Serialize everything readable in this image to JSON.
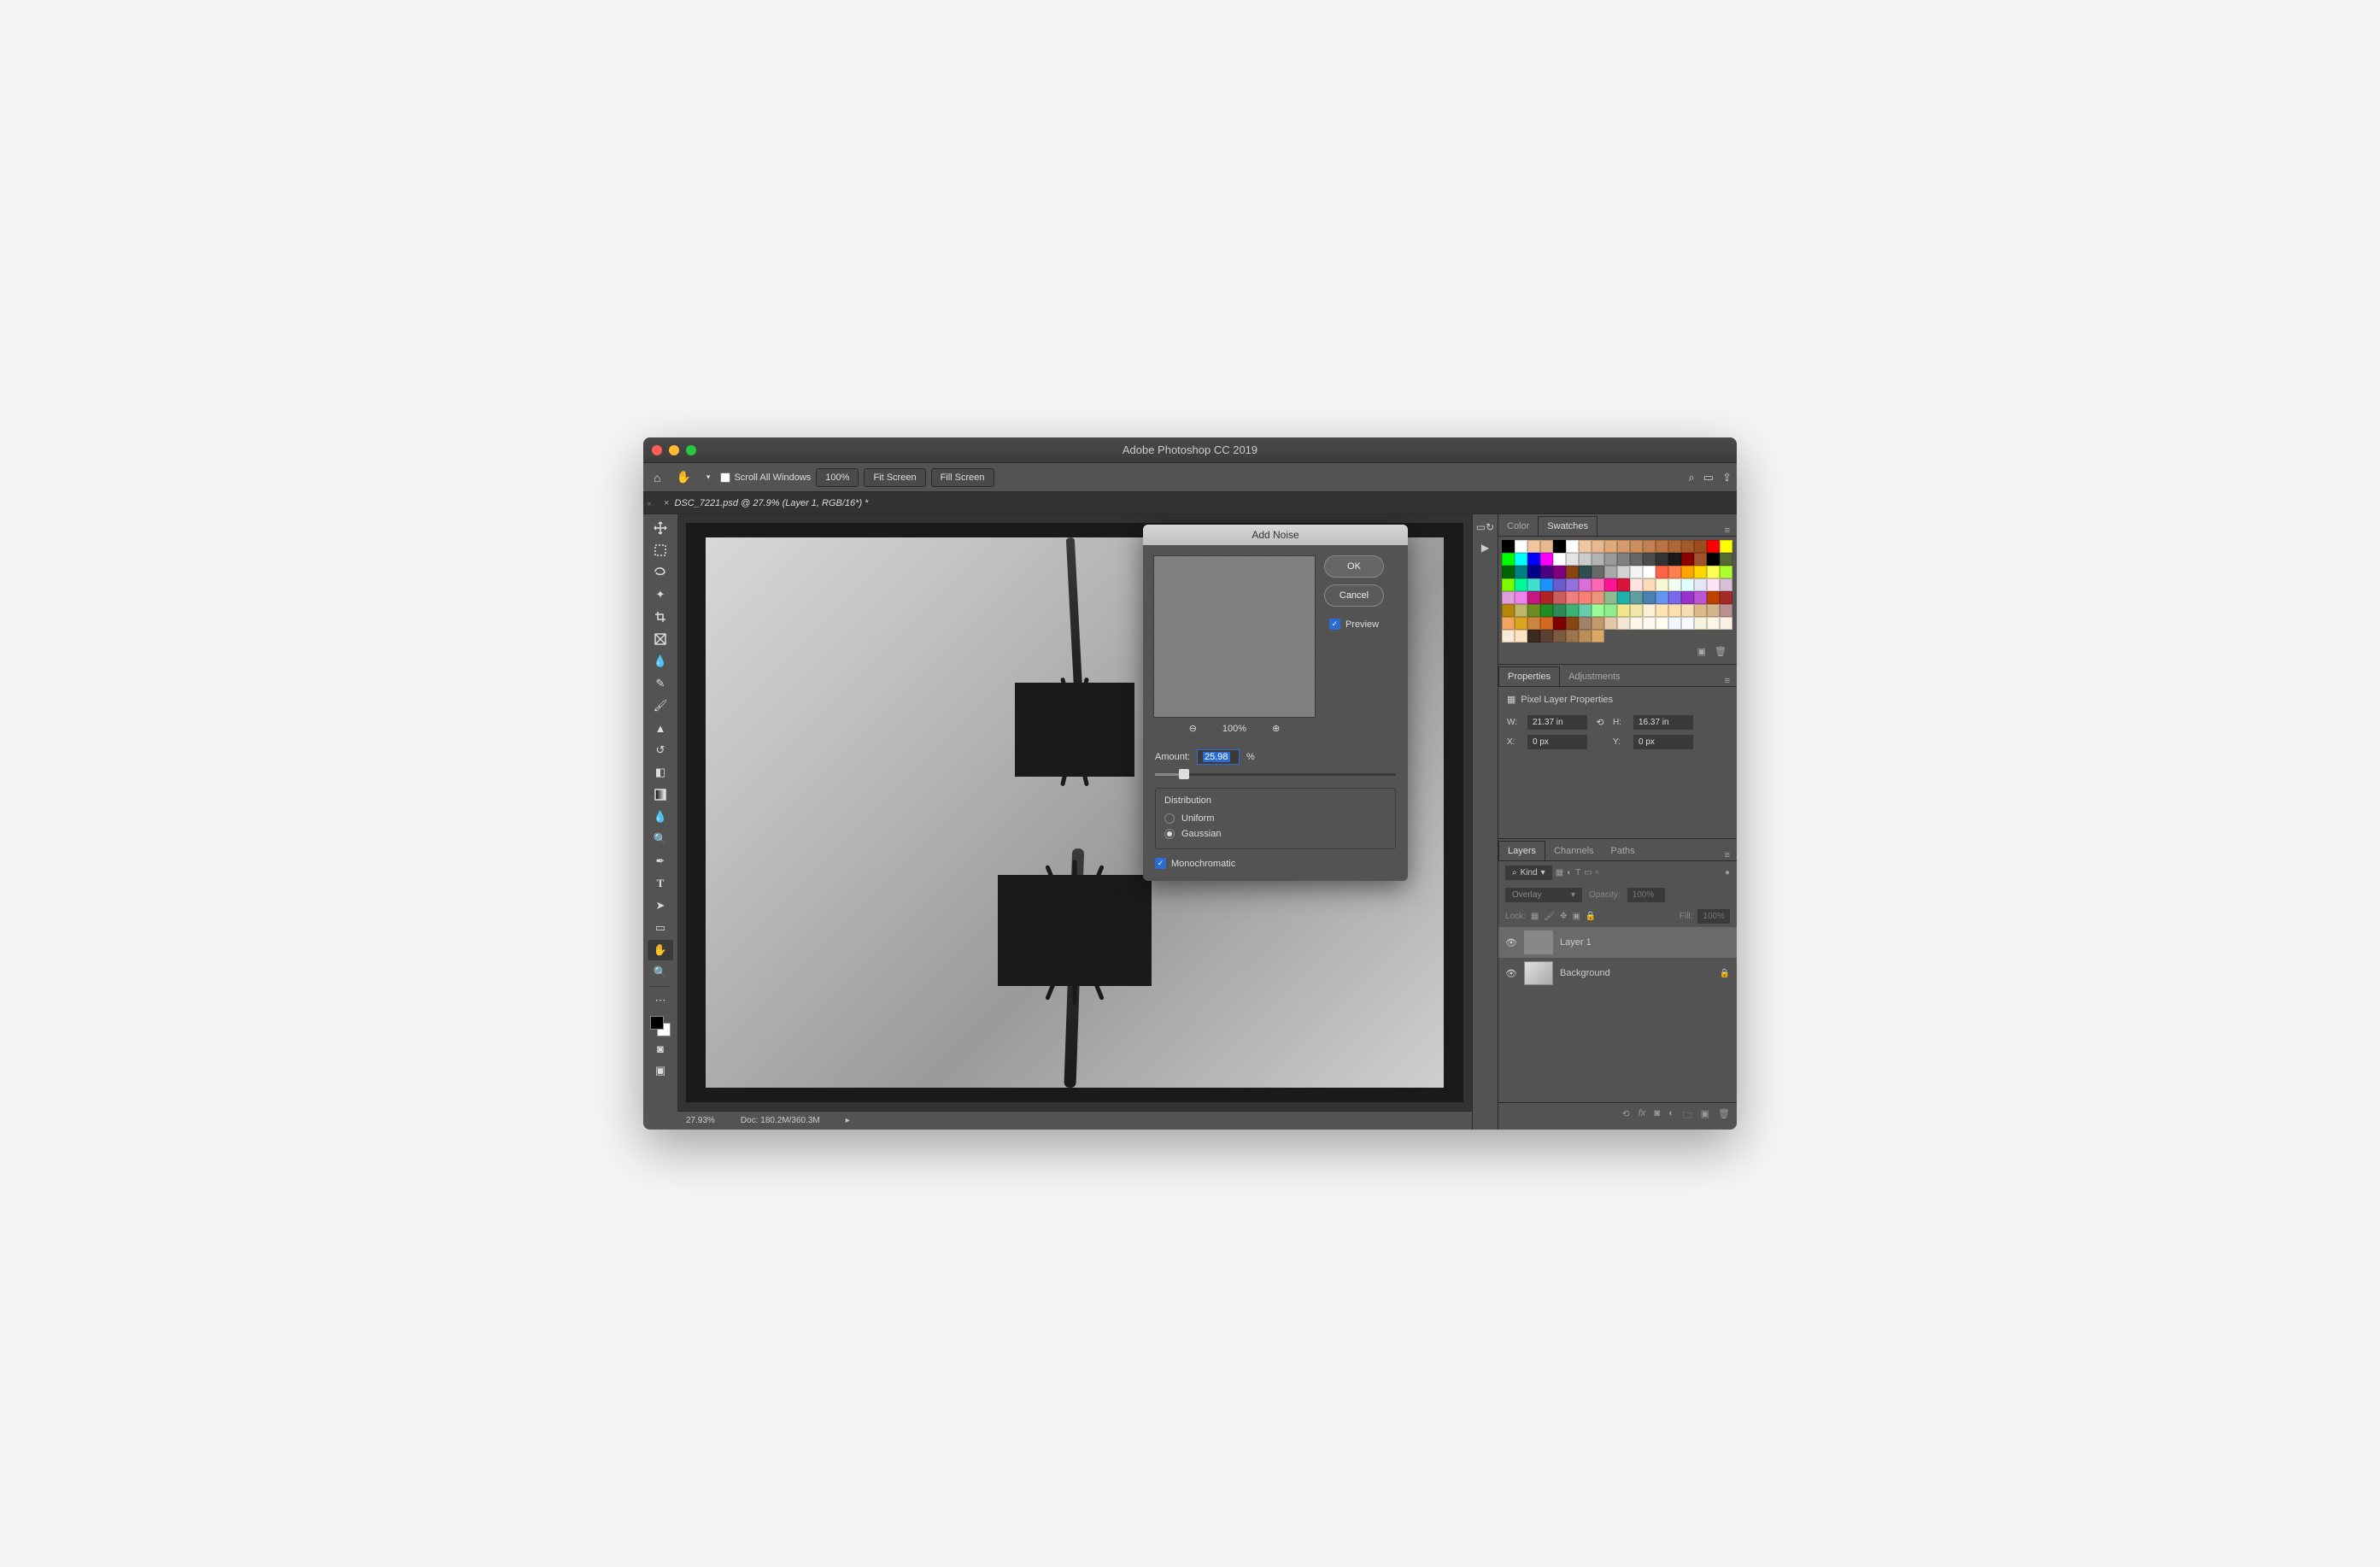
{
  "app": {
    "title": "Adobe Photoshop CC 2019"
  },
  "optionsBar": {
    "scrollAll": "Scroll All Windows",
    "zoomBtn": "100%",
    "fitScreen": "Fit Screen",
    "fillScreen": "Fill Screen"
  },
  "documentTab": "DSC_7221.psd @ 27.9% (Layer 1, RGB/16*) *",
  "statusBar": {
    "zoom": "27.93%",
    "docsize": "Doc: 180.2M/360.3M"
  },
  "panels": {
    "colorTab": "Color",
    "swatchesTab": "Swatches",
    "propertiesTab": "Properties",
    "adjustmentsTab": "Adjustments",
    "layersTab": "Layers",
    "channelsTab": "Channels",
    "pathsTab": "Paths"
  },
  "properties": {
    "heading": "Pixel Layer Properties",
    "W": "21.37 in",
    "H": "16.37 in",
    "X": "0 px",
    "Y": "0 px"
  },
  "layers": {
    "kind": "Kind",
    "blend": "Overlay",
    "opacityLabel": "Opacity:",
    "opacity": "100%",
    "lockLabel": "Lock:",
    "fillLabel": "Fill:",
    "fill": "100%",
    "items": [
      {
        "name": "Layer 1",
        "selected": true,
        "locked": false
      },
      {
        "name": "Background",
        "selected": false,
        "locked": true
      }
    ]
  },
  "dialog": {
    "title": "Add Noise",
    "ok": "OK",
    "cancel": "Cancel",
    "preview": "Preview",
    "previewZoom": "100%",
    "amountLabel": "Amount:",
    "amount": "25.98",
    "pct": "%",
    "distributionLabel": "Distribution",
    "uniform": "Uniform",
    "gaussian": "Gaussian",
    "mono": "Monochromatic"
  },
  "swatchColors": [
    "#000000",
    "#ffffff",
    "#f2c6a0",
    "#e8b98f",
    "#000000",
    "#ffffff",
    "#f2c6a0",
    "#e8b98f",
    "#dfa87a",
    "#d59b6c",
    "#cc8e5e",
    "#c28150",
    "#b97443",
    "#af6736",
    "#a55a2a",
    "#9b4d1e",
    "#ff0000",
    "#ffff00",
    "#00ff00",
    "#00ffff",
    "#0000ff",
    "#ff00ff",
    "#ffffff",
    "#e5e5e5",
    "#cccccc",
    "#b3b3b3",
    "#999999",
    "#808080",
    "#666666",
    "#4d4d4d",
    "#333333",
    "#1a1a1a",
    "#8b0000",
    "#a0522d",
    "#000000",
    "#556b2f",
    "#006400",
    "#008080",
    "#00008b",
    "#4b0082",
    "#800080",
    "#8b4513",
    "#2f4f4f",
    "#696969",
    "#a9a9a9",
    "#d3d3d3",
    "#f5f5f5",
    "#ffffff",
    "#ff6347",
    "#ff7f50",
    "#ffa500",
    "#ffd700",
    "#ffff54",
    "#adff2f",
    "#7cfc00",
    "#00fa9a",
    "#40e0d0",
    "#1e90ff",
    "#6a5acd",
    "#9370db",
    "#da70d6",
    "#ff69b4",
    "#ff1493",
    "#dc143c",
    "#ffe4e1",
    "#ffdab9",
    "#fafad2",
    "#f0fff0",
    "#e0ffff",
    "#e6e6fa",
    "#ffe4f3",
    "#d8bfd8",
    "#dda0dd",
    "#ee82ee",
    "#c71585",
    "#b22222",
    "#cd5c5c",
    "#f08080",
    "#fa8072",
    "#e9967a",
    "#8fbc8f",
    "#20b2aa",
    "#5f9ea0",
    "#4682b4",
    "#6495ed",
    "#7b68ee",
    "#9932cc",
    "#ba55d3",
    "#c04000",
    "#a52a2a",
    "#b8860b",
    "#bdb76b",
    "#6b8e23",
    "#228b22",
    "#2e8b57",
    "#3cb371",
    "#66cdaa",
    "#98fb98",
    "#90ee90",
    "#f0e68c",
    "#eee8aa",
    "#ffefd5",
    "#ffe4b5",
    "#ffdead",
    "#f5deb3",
    "#deb887",
    "#d2b48c",
    "#bc8f8f",
    "#f4a460",
    "#daa520",
    "#cd853f",
    "#d2691e",
    "#800000",
    "#8b4513",
    "#a0826d",
    "#c19a6b",
    "#e3c9a8",
    "#f5e6d3",
    "#fdf5e6",
    "#fffaf0",
    "#fffff0",
    "#f0f8ff",
    "#f8f8ff",
    "#f5f5dc",
    "#fdf5e6",
    "#faf0e6",
    "#faebd7",
    "#ffe4c4",
    "#3d2b1f",
    "#5c4033",
    "#7b5a3f",
    "#9a744c",
    "#b98e58",
    "#d8a865"
  ]
}
